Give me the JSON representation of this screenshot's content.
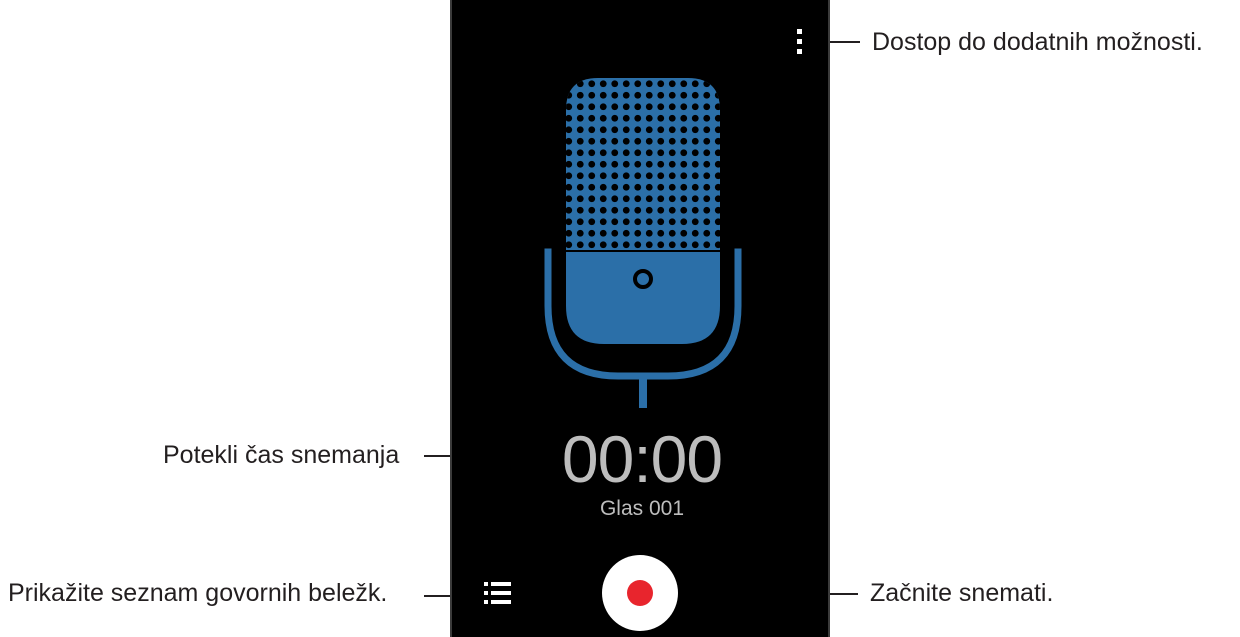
{
  "callouts": {
    "more_options": "Dostop do dodatnih možnosti.",
    "elapsed_time": "Potekli čas snemanja",
    "voice_memo_list": "Prikažite seznam govornih beležk.",
    "start_recording": "Začnite snemati."
  },
  "screen": {
    "timer": "00:00",
    "recording_name": "Glas 001",
    "icons": {
      "menu": "more-vertical-icon",
      "microphone": "microphone-icon",
      "list": "list-icon",
      "record": "record-icon"
    }
  },
  "colors": {
    "screen_bg": "#000000",
    "mic_blue": "#2b6fa8",
    "timer_text": "#bdbdbd",
    "record_red": "#e8252d",
    "callout_line": "#231f20"
  }
}
